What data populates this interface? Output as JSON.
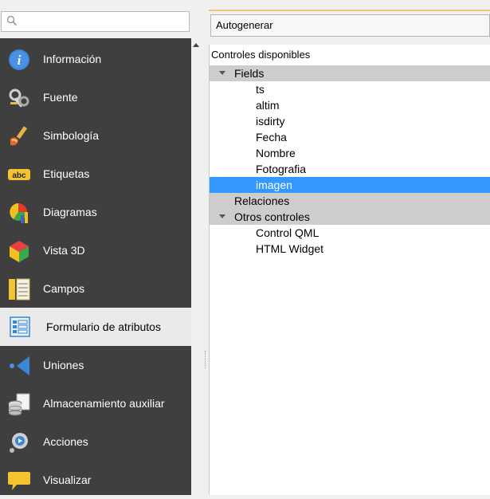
{
  "search": {
    "placeholder": ""
  },
  "sidebar": {
    "items": [
      {
        "label": "Información",
        "icon": "info-icon"
      },
      {
        "label": "Fuente",
        "icon": "source-icon"
      },
      {
        "label": "Simbología",
        "icon": "symbology-icon"
      },
      {
        "label": "Etiquetas",
        "icon": "labels-icon"
      },
      {
        "label": "Diagramas",
        "icon": "diagrams-icon"
      },
      {
        "label": "Vista 3D",
        "icon": "3d-view-icon"
      },
      {
        "label": "Campos",
        "icon": "fields-icon"
      },
      {
        "label": "Formulario de atributos",
        "icon": "attributes-form-icon",
        "selected": true
      },
      {
        "label": "Uniones",
        "icon": "joins-icon"
      },
      {
        "label": "Almacenamiento auxiliar",
        "icon": "auxiliary-storage-icon"
      },
      {
        "label": "Acciones",
        "icon": "actions-icon"
      },
      {
        "label": "Visualizar",
        "icon": "display-icon"
      }
    ]
  },
  "form": {
    "mode_label": "Autogenerar",
    "tree_header": "Controles disponibles",
    "fields_group": "Fields",
    "fields": [
      "ts",
      "altim",
      "isdirty",
      "Fecha",
      "Nombre",
      "Fotografia",
      "imagen"
    ],
    "selected_field": "imagen",
    "relations_group": "Relaciones",
    "other_group": "Otros controles",
    "other_controls": [
      "Control QML",
      "HTML Widget"
    ]
  },
  "colors": {
    "sidebar_bg": "#3f3f3f",
    "selection": "#3399ff",
    "group_row": "#cdcdcd"
  }
}
